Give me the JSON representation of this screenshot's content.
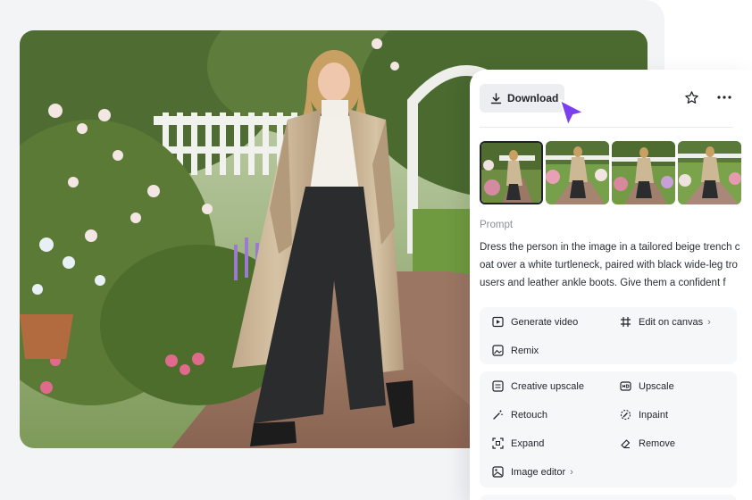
{
  "toolbar": {
    "download_label": "Download",
    "star_icon": "star-icon",
    "more_icon": "more-horizontal-icon"
  },
  "thumbnails": {
    "count_visible": 4,
    "selected_index": 0
  },
  "prompt": {
    "label": "Prompt",
    "text": "Dress the person in the image in a tailored beige trench coat over a white turtleneck, paired with black wide-leg trousers and leather ankle boots. Give them a confident f"
  },
  "actions": {
    "generate_video": "Generate video",
    "edit_on_canvas": "Edit on canvas",
    "remix": "Remix",
    "creative_upscale": "Creative upscale",
    "upscale": "Upscale",
    "retouch": "Retouch",
    "inpaint": "Inpaint",
    "expand": "Expand",
    "remove": "Remove",
    "image_editor": "Image editor"
  },
  "colors": {
    "accent_cursor": "#7b3ff2",
    "panel_bg": "#ffffff",
    "card_bg": "#f6f7f9",
    "backdrop": "#f3f4f6"
  }
}
